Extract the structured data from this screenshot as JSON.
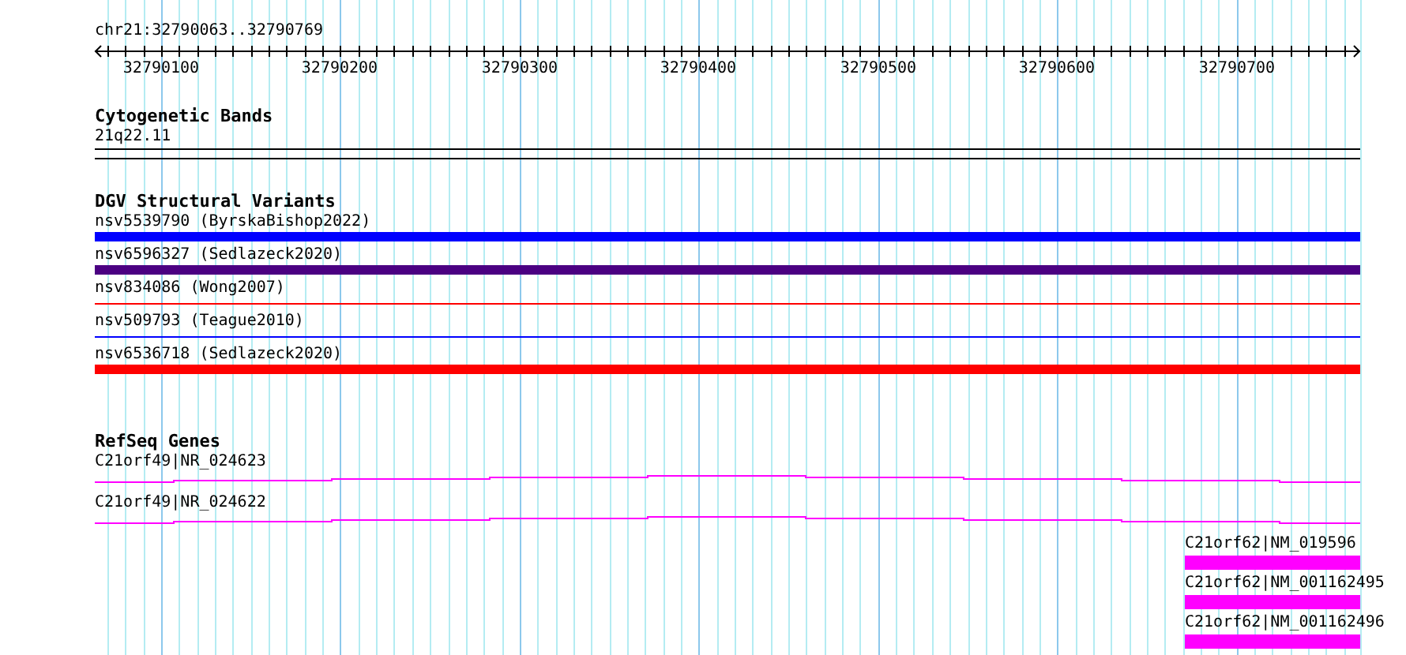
{
  "ruler": {
    "title": "chr21:32790063..32790769",
    "tick_labels": [
      "32790100",
      "32790200",
      "32790300",
      "32790400",
      "32790500",
      "32790600",
      "32790700"
    ]
  },
  "tracks": [
    {
      "title": "Cytogenetic Bands",
      "features": [
        {
          "kind": "band",
          "label": "21q22.11"
        }
      ]
    },
    {
      "title": "DGV Structural Variants",
      "features": [
        {
          "kind": "thick",
          "label": "nsv5539790 (ByrskaBishop2022)",
          "color": "#0000ff"
        },
        {
          "kind": "thick",
          "label": "nsv6596327 (Sedlazeck2020)",
          "color": "#4b0082"
        },
        {
          "kind": "thin",
          "label": "nsv834086 (Wong2007)",
          "color": "#ff0000"
        },
        {
          "kind": "thin",
          "label": "nsv509793 (Teague2010)",
          "color": "#0000ff"
        },
        {
          "kind": "thick",
          "label": "nsv6536718 (Sedlazeck2020)",
          "color": "#ff0000"
        }
      ]
    },
    {
      "title": "RefSeq Genes",
      "features": [
        {
          "kind": "transcript",
          "label": "C21orf49|NR_024623"
        },
        {
          "kind": "transcript",
          "label": "C21orf49|NR_024622"
        },
        {
          "kind": "exon",
          "label": "C21orf62|NM_019596"
        },
        {
          "kind": "exon",
          "label": "C21orf62|NM_001162495"
        },
        {
          "kind": "exon",
          "label": "C21orf62|NM_001162496"
        }
      ]
    }
  ]
}
